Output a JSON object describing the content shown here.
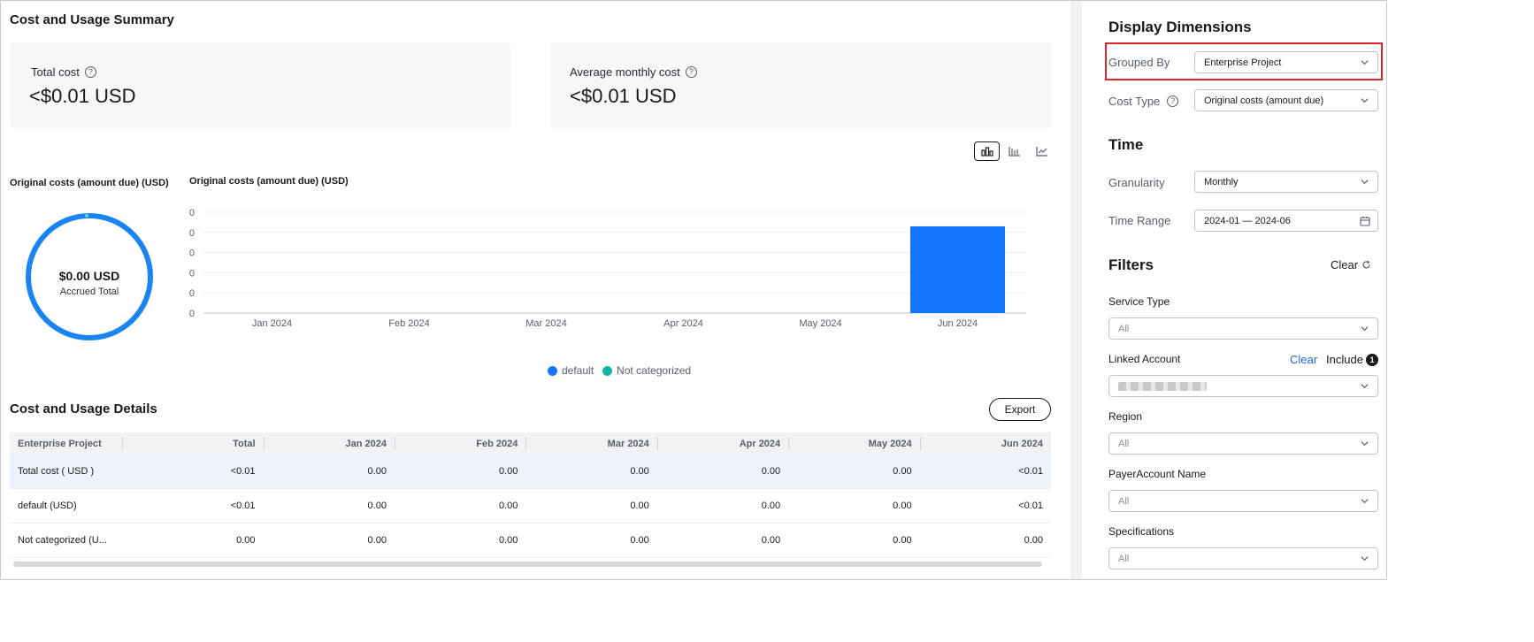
{
  "summary": {
    "title": "Cost and Usage Summary",
    "total_cost_label": "Total cost",
    "total_cost_value": "<$0.01 USD",
    "avg_cost_label": "Average monthly cost",
    "avg_cost_value": "<$0.01 USD"
  },
  "view_switch": [
    "bar-chart-icon",
    "stacked-bar-icon",
    "line-chart-icon"
  ],
  "donut": {
    "title": "Original costs (amount due) (USD)",
    "value": "$0.00 USD",
    "subtitle": "Accrued Total",
    "color": "#1a84f2"
  },
  "chart_data": {
    "type": "bar",
    "title": "Original costs (amount due) (USD)",
    "categories": [
      "Jan 2024",
      "Feb 2024",
      "Mar 2024",
      "Apr 2024",
      "May 2024",
      "Jun 2024"
    ],
    "y_tick_labels": [
      "0",
      "0",
      "0",
      "0",
      "0",
      "0"
    ],
    "series": [
      {
        "name": "default",
        "color": "#1476ff",
        "values": [
          0,
          0,
          0,
          0,
          0,
          0.0043
        ]
      },
      {
        "name": "Not categorized",
        "color": "#12b5a6",
        "values": [
          0,
          0,
          0,
          0,
          0,
          0
        ]
      }
    ],
    "ylim": [
      0,
      0.005
    ],
    "grid": true,
    "legend_position": "bottom"
  },
  "details": {
    "title": "Cost and Usage Details",
    "export_label": "Export",
    "columns": [
      "Enterprise Project",
      "Total",
      "Jan 2024",
      "Feb 2024",
      "Mar 2024",
      "Apr 2024",
      "May 2024",
      "Jun 2024"
    ],
    "rows": [
      [
        "Total cost ( USD )",
        "<0.01",
        "0.00",
        "0.00",
        "0.00",
        "0.00",
        "0.00",
        "<0.01"
      ],
      [
        "default (USD)",
        "<0.01",
        "0.00",
        "0.00",
        "0.00",
        "0.00",
        "0.00",
        "<0.01"
      ],
      [
        "Not categorized (U...",
        "0.00",
        "0.00",
        "0.00",
        "0.00",
        "0.00",
        "0.00",
        "0.00"
      ]
    ]
  },
  "panel": {
    "display_title": "Display Dimensions",
    "grouped_by_label": "Grouped By",
    "grouped_by_value": "Enterprise Project",
    "cost_type_label": "Cost Type",
    "cost_type_value": "Original costs (amount due)",
    "time_title": "Time",
    "granularity_label": "Granularity",
    "granularity_value": "Monthly",
    "time_range_label": "Time Range",
    "time_range_value": "2024-01 — 2024-06",
    "filters_title": "Filters",
    "filters_clear": "Clear",
    "service_type_label": "Service Type",
    "service_type_value": "All",
    "linked_account_label": "Linked Account",
    "linked_account_clear": "Clear",
    "linked_account_include": "Include",
    "linked_account_count": "1",
    "region_label": "Region",
    "region_value": "All",
    "payer_label": "PayerAccount Name",
    "payer_value": "All",
    "spec_label": "Specifications",
    "spec_value": "All",
    "highlight_color": "#e0222b"
  }
}
